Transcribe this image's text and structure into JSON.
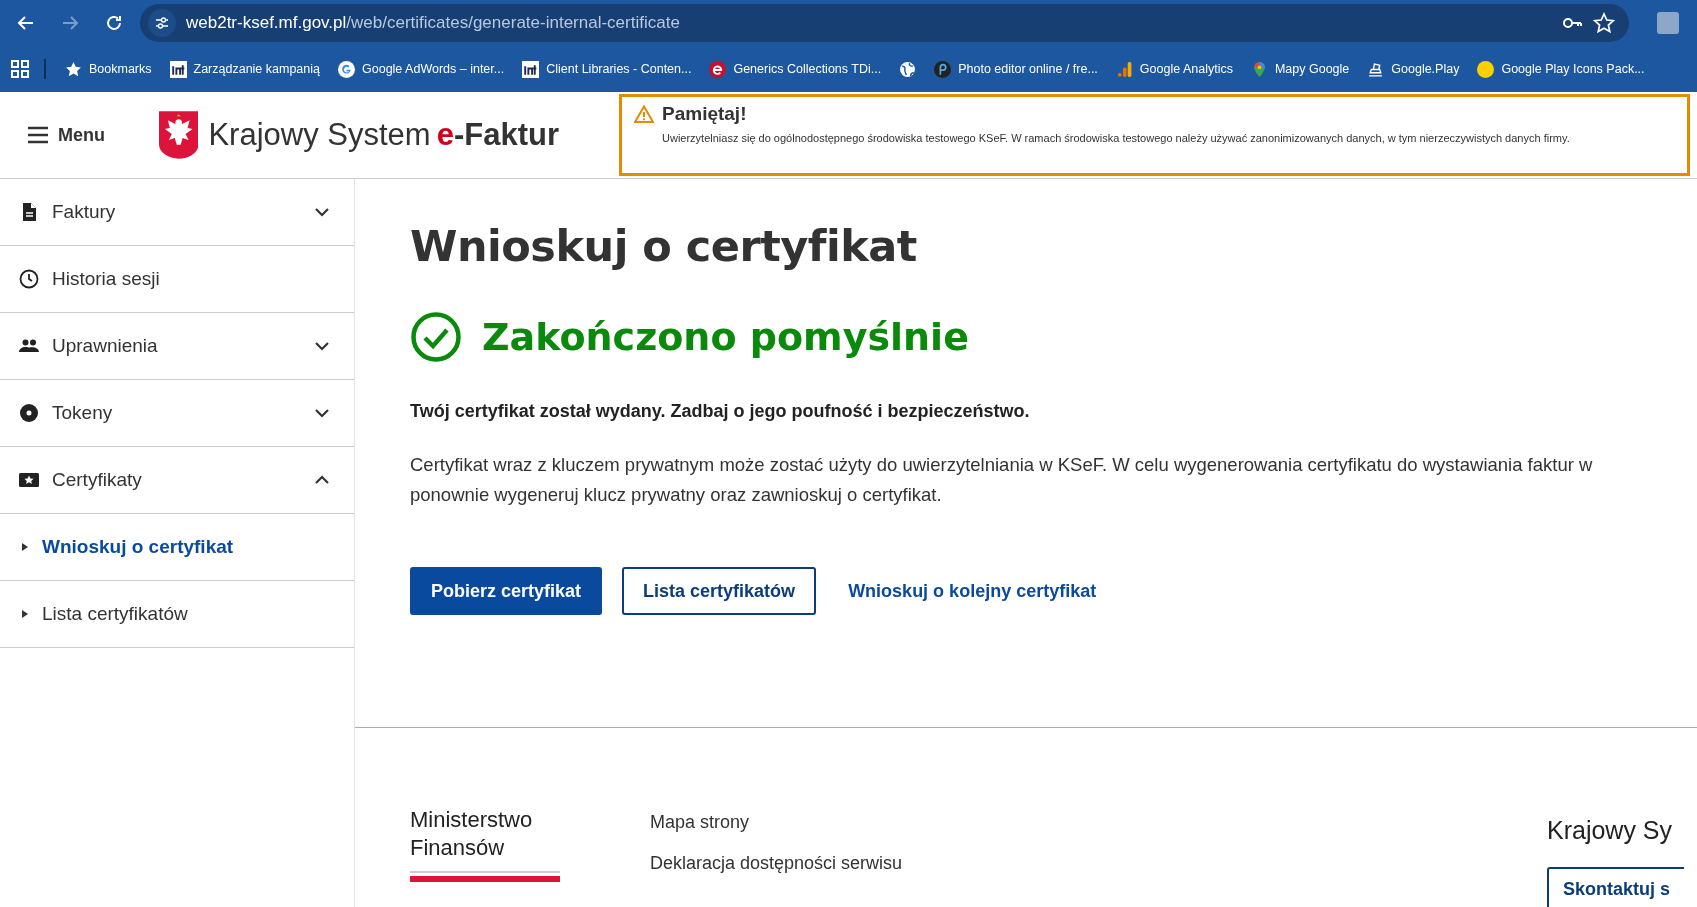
{
  "browser": {
    "url_host": "web2tr-ksef.mf.gov.pl",
    "url_path": "/web/certificates/generate-internal-certificate",
    "bookmarks": [
      "Bookmarks",
      "Zarządzanie kampanią",
      "Google AdWords – inter...",
      "Client Libraries - Conten...",
      "Generics Collections TDi...",
      "Photo editor online / fre...",
      "Google Analytics",
      "Mapy Google",
      "Google.Play",
      "Google Play Icons Pack..."
    ]
  },
  "header": {
    "menu_label": "Menu",
    "brand_prefix": "Krajowy System",
    "brand_e": "e",
    "brand_suffix": "-Faktur",
    "notice": {
      "title": "Pamiętaj!",
      "text": "Uwierzytelniasz się do ogólnodostępnego środowiska testowego KSeF. W ramach środowiska testowego należy używać zanonimizowanych danych, w tym nierzeczywistych danych firmy."
    }
  },
  "sidebar": {
    "items": [
      {
        "label": "Faktury",
        "expanded": false
      },
      {
        "label": "Historia sesji"
      },
      {
        "label": "Uprawnienia",
        "expanded": false
      },
      {
        "label": "Tokeny",
        "expanded": false
      },
      {
        "label": "Certyfikaty",
        "expanded": true,
        "children": [
          {
            "label": "Wnioskuj o certyfikat",
            "selected": true
          },
          {
            "label": "Lista certyfikatów",
            "selected": false
          }
        ]
      }
    ]
  },
  "main": {
    "title": "Wnioskuj o certyfikat",
    "status": "Zakończono pomyślnie",
    "lead": "Twój certyfikat został wydany. Zadbaj o jego poufność i bezpieczeństwo.",
    "body": "Certyfikat wraz z kluczem prywatnym może zostać użyty do uwierzytelniania w KSeF. W celu wygenerowania certyfikatu do wystawiania faktur w ponownie wygeneruj klucz prywatny oraz zawnioskuj o certyfikat.",
    "actions": [
      {
        "kind": "primary",
        "label": "Pobierz certyfikat"
      },
      {
        "kind": "outline",
        "label": "Lista certyfikatów"
      },
      {
        "kind": "link",
        "label": "Wnioskuj o kolejny certyfikat"
      }
    ]
  },
  "footer": {
    "ministry": "Ministerstwo Finansów",
    "links": [
      "Mapa strony",
      "Deklaracja dostępności serwisu"
    ],
    "right_title": "Krajowy Sy",
    "right_button": "Skontaktuj s"
  }
}
